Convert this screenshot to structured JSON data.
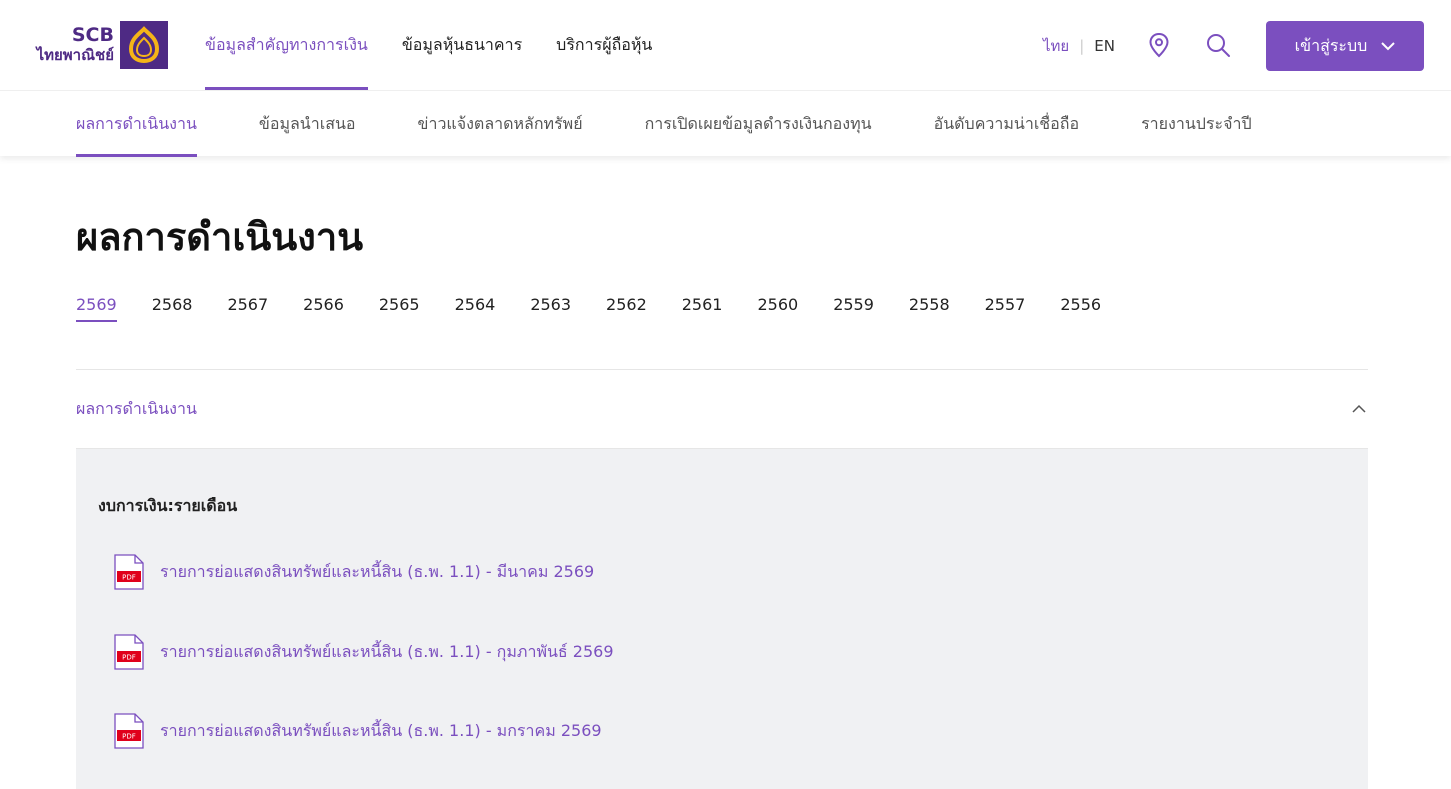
{
  "brand": {
    "scb": "SCB",
    "thai_name": "ไทยพาณิชย์"
  },
  "main_nav": [
    {
      "label": "ข้อมูลสำคัญทางการเงิน",
      "active": true
    },
    {
      "label": "ข้อมูลหุ้นธนาคาร",
      "active": false
    },
    {
      "label": "บริการผู้ถือหุ้น",
      "active": false
    }
  ],
  "lang": {
    "th": "ไทย",
    "en": "EN"
  },
  "icons": {
    "location": "location-pin-icon",
    "search": "search-icon",
    "chevron": "chevron-down-icon",
    "pdf": "pdf-file-icon"
  },
  "login": {
    "label": "เข้าสู่ระบบ"
  },
  "sub_nav": [
    {
      "label": "ผลการดำเนินงาน",
      "active": true
    },
    {
      "label": "ข้อมูลนำเสนอ",
      "active": false
    },
    {
      "label": "ข่าวแจ้งตลาดหลักทรัพย์",
      "active": false
    },
    {
      "label": "การเปิดเผยข้อมูลดำรงเงินกองทุน",
      "active": false
    },
    {
      "label": "อันดับความน่าเชื่อถือ",
      "active": false
    },
    {
      "label": "รายงานประจำปี",
      "active": false
    }
  ],
  "page": {
    "title": "ผลการดำเนินงาน"
  },
  "years": [
    "2569",
    "2568",
    "2567",
    "2566",
    "2565",
    "2564",
    "2563",
    "2562",
    "2561",
    "2560",
    "2559",
    "2558",
    "2557",
    "2556"
  ],
  "selected_year": "2569",
  "accordion": {
    "title": "ผลการดำเนินงาน",
    "section_title": "งบการเงิน:รายเดือน",
    "documents": [
      {
        "label": "รายการย่อแสดงสินทรัพย์และหนี้สิน (ธ.พ. 1.1) - มีนาคม 2569",
        "badge": "PDF"
      },
      {
        "label": "รายการย่อแสดงสินทรัพย์และหนี้สิน (ธ.พ. 1.1) - กุมภาพันธ์ 2569",
        "badge": "PDF"
      },
      {
        "label": "รายการย่อแสดงสินทรัพย์และหนี้สิน (ธ.พ. 1.1) - มกราคม 2569",
        "badge": "PDF"
      }
    ]
  },
  "colors": {
    "accent": "#7b4fbf",
    "brand": "#4e2a84",
    "logo_gold": "#f5b418",
    "pdf_red": "#e0001b",
    "panel_bg": "#f0f1f3"
  }
}
